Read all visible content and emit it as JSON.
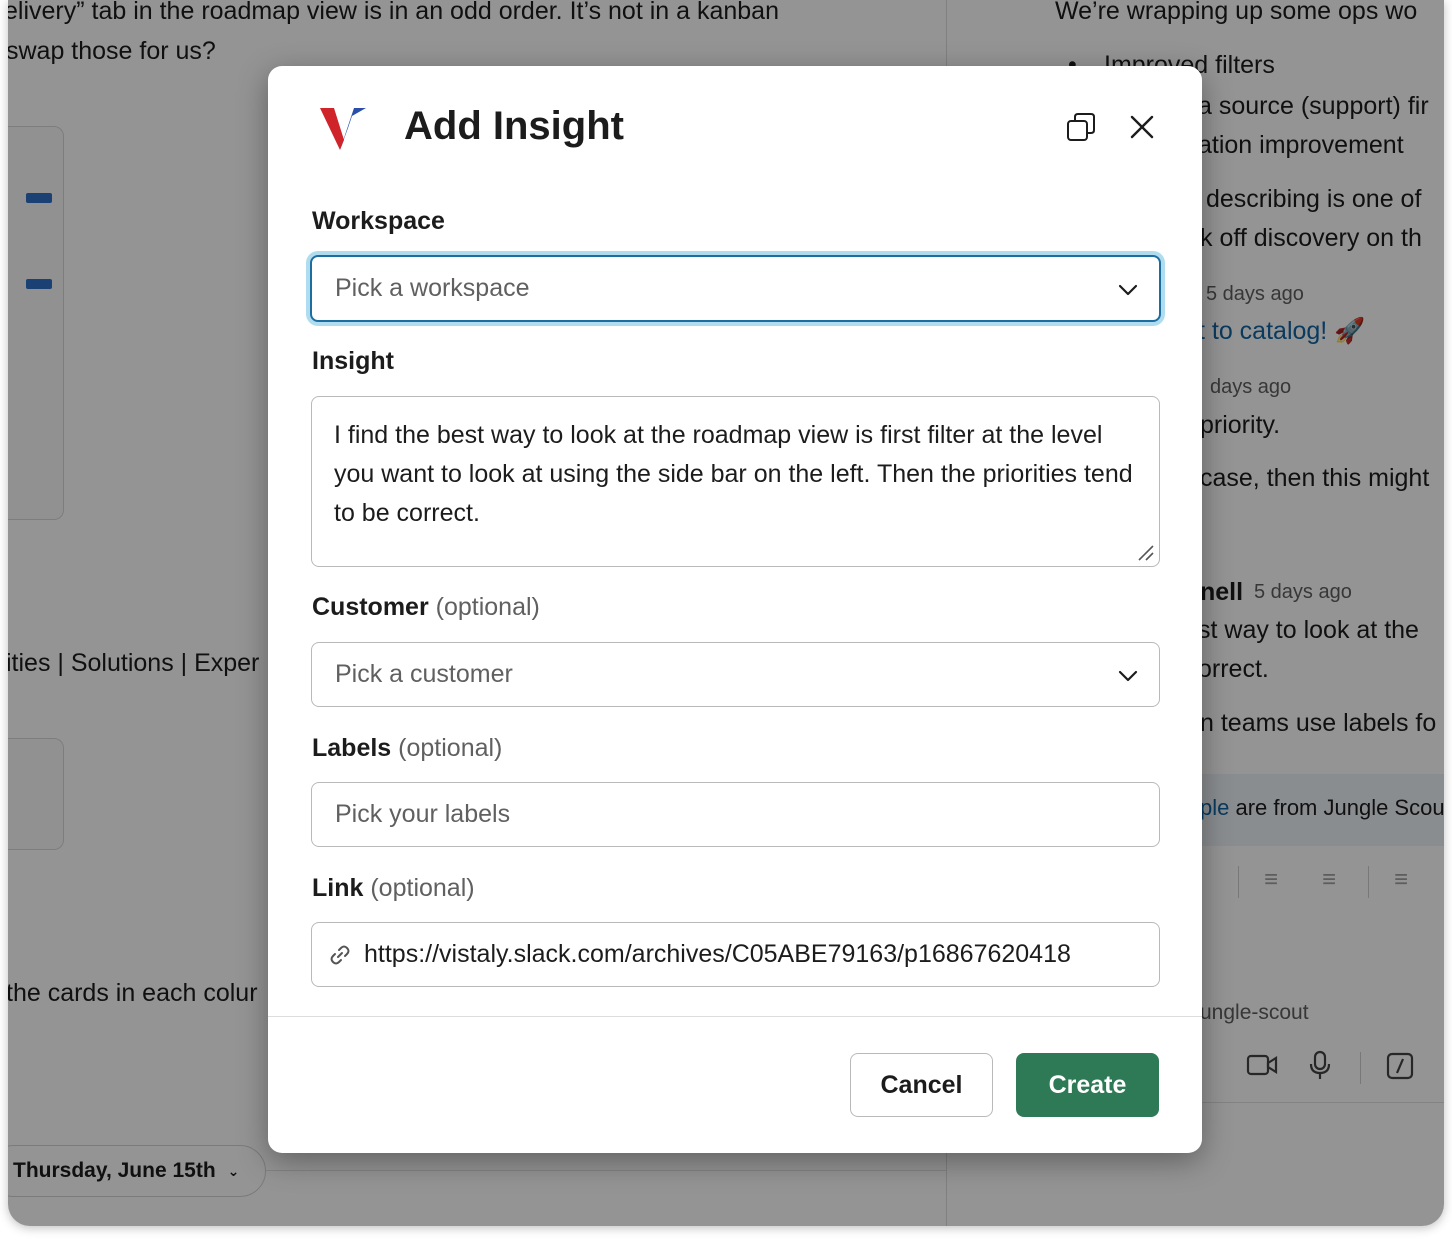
{
  "background": {
    "left_lines": [
      "elivery” tab in the roadmap view is in an odd order. It’s not in a kanban",
      "swap those for us?"
    ],
    "left_mid_text": "ities | Solutions | Exper",
    "left_low_text": "the cards in each colur",
    "date_pill": "Thursday, June 15th",
    "right_lines": {
      "r1": "We’re wrapping up some ops wo",
      "r2": "Improved filters",
      "r3": "a source (support) fir",
      "r4": "ation improvement",
      "r5": "describing is one of",
      "r6": "k off discovery on th",
      "r7": "5 days ago",
      "r8": "t to catalog! 🚀",
      "r9": "days ago",
      "r10": "priority.",
      "r11": "case, then this might",
      "r12_name": "nell",
      "r12_time": "5 days ago",
      "r13": "st way to look at the",
      "r14": "orrect.",
      "r15": "n teams use labels fo",
      "r16_link": "ple",
      "r16_rest": " are from Jungle Scou",
      "r17": "ungle-scout"
    }
  },
  "modal": {
    "title": "Add Insight",
    "workspace_label": "Workspace",
    "workspace_placeholder": "Pick a workspace",
    "insight_label": "Insight",
    "insight_value": "I find the best way to look at the roadmap view is first filter at the level you want to look at using the side bar on the left. Then the priorities tend to be correct.",
    "customer_label": "Customer",
    "customer_placeholder": "Pick a customer",
    "labels_label": "Labels",
    "labels_placeholder": "Pick your labels",
    "link_label": "Link",
    "link_value": "https://vistaly.slack.com/archives/C05ABE79163/p16867620418",
    "optional_text": "(optional)",
    "cancel_label": "Cancel",
    "create_label": "Create"
  },
  "colors": {
    "create_button": "#2e7a56",
    "focus_ring": "#1d9bd1",
    "logo_red": "#d0242b",
    "logo_blue": "#2b4fa8"
  }
}
